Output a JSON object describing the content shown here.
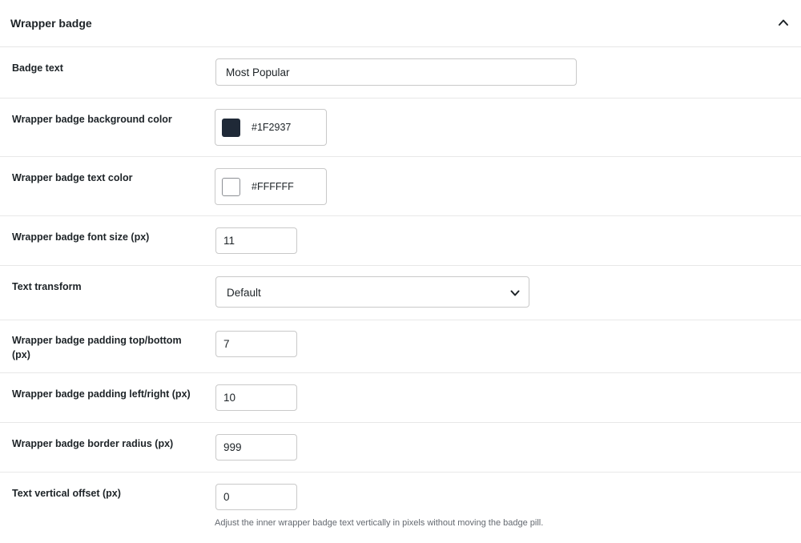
{
  "section": {
    "title": "Wrapper badge",
    "collapse_icon": "chevron-up-icon"
  },
  "fields": {
    "badge_text": {
      "label": "Badge text",
      "value": "Most Popular"
    },
    "bg_color": {
      "label": "Wrapper badge background color",
      "value": "#1F2937",
      "swatch": "#1F2937"
    },
    "text_color": {
      "label": "Wrapper badge text color",
      "value": "#FFFFFF",
      "swatch": "#FFFFFF"
    },
    "font_size": {
      "label": "Wrapper badge font size (px)",
      "value": "11"
    },
    "text_transform": {
      "label": "Text transform",
      "value": "Default",
      "icon": "chevron-down-icon"
    },
    "padding_tb": {
      "label": "Wrapper badge padding top/bottom (px)",
      "value": "7"
    },
    "padding_lr": {
      "label": "Wrapper badge padding left/right (px)",
      "value": "10"
    },
    "border_radius": {
      "label": "Wrapper badge border radius (px)",
      "value": "999"
    },
    "vertical_offset": {
      "label": "Text vertical offset (px)",
      "value": "0",
      "help": "Adjust the inner wrapper badge text vertically in pixels without moving the badge pill."
    }
  }
}
